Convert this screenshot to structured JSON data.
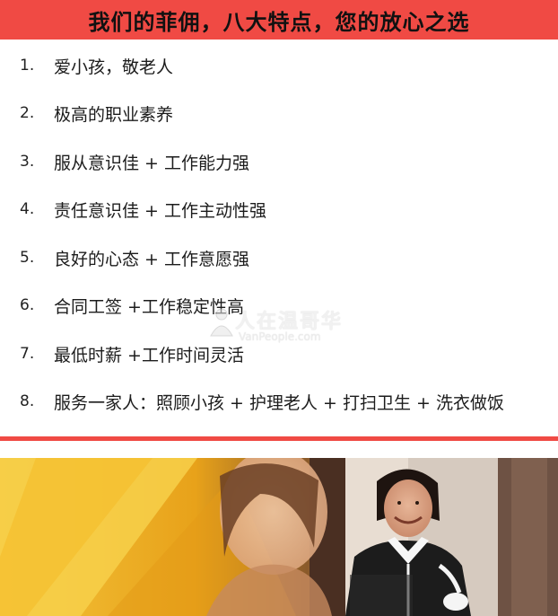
{
  "header": {
    "title": "我们的菲佣，八大特点，您的放心之选"
  },
  "features": [
    {
      "num": "1.",
      "text": "爱小孩，敬老人"
    },
    {
      "num": "2.",
      "text": "极高的职业素养"
    },
    {
      "num": "3.",
      "text": "服从意识佳 + 工作能力强"
    },
    {
      "num": "4.",
      "text": "责任意识佳 + 工作主动性强"
    },
    {
      "num": "5.",
      "text": "良好的心态 + 工作意愿强"
    },
    {
      "num": "6.",
      "text": "合同工签 +工作稳定性高"
    },
    {
      "num": "7.",
      "text": "最低时薪 +工作时间灵活"
    },
    {
      "num": "8.",
      "text": "服务一家人：照顾小孩 + 护理老人 + 打扫卫生 + 洗衣做饭"
    }
  ],
  "watermark": {
    "main": "人在温哥华",
    "sub": "VanPeople.com"
  },
  "colors": {
    "accent_red": "#f04a44",
    "photo_yellow": "#f2b21c",
    "uniform_black": "#1c1c1c"
  }
}
